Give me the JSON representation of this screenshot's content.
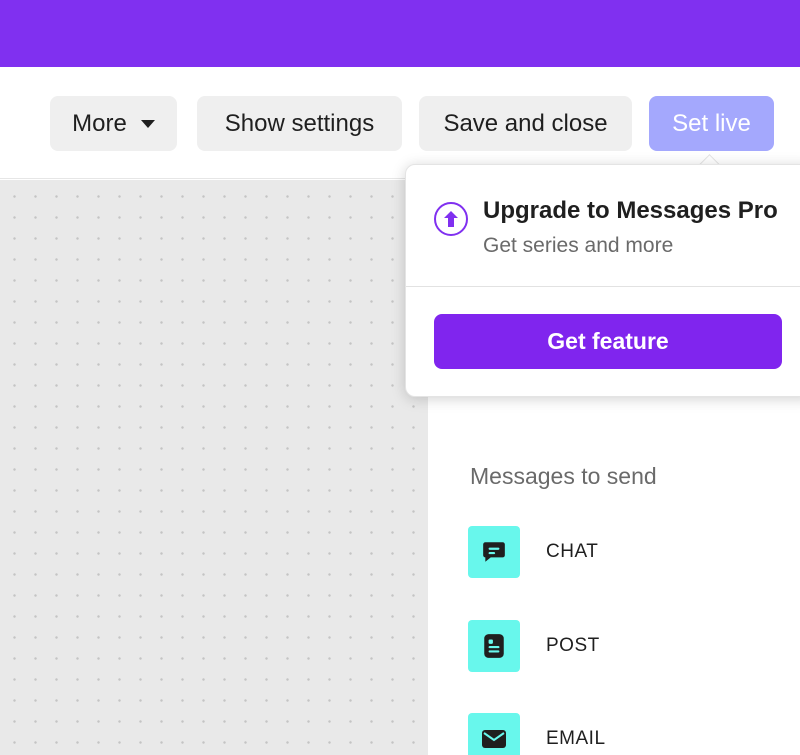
{
  "toolbar": {
    "more_label": "More",
    "show_settings_label": "Show settings",
    "save_close_label": "Save and close",
    "set_live_label": "Set live"
  },
  "popover": {
    "title": "Upgrade to Messages Pro",
    "subtitle": "Get series and more",
    "cta_label": "Get feature",
    "icon": "upload-arrow-circle-icon"
  },
  "panel": {
    "section_title": "Messages to send",
    "items": [
      {
        "label": "CHAT",
        "icon": "chat-bubble-icon"
      },
      {
        "label": "POST",
        "icon": "post-document-icon"
      },
      {
        "label": "EMAIL",
        "icon": "envelope-icon"
      }
    ]
  },
  "colors": {
    "brand": "#8030f0",
    "cta": "#8025ee",
    "set_live": "#a4a8fd",
    "item_icon_bg": "#68f7ec"
  }
}
